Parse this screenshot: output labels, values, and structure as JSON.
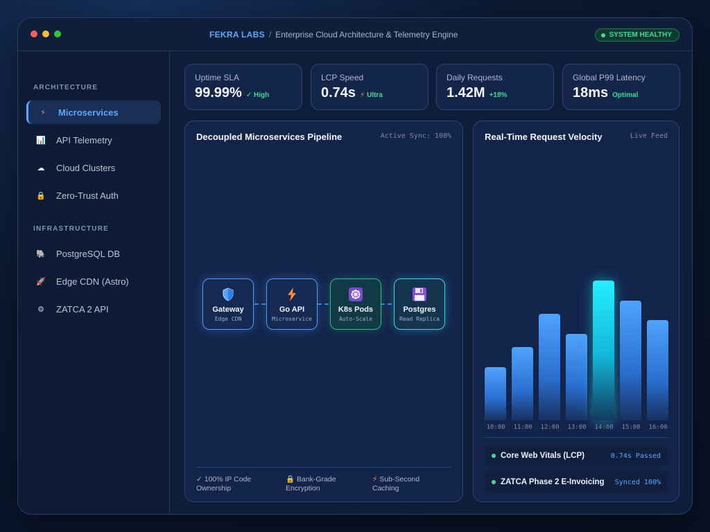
{
  "titlebar": {
    "brand": "FEKRA LABS",
    "separator": "/",
    "title": "Enterprise Cloud Architecture & Telemetry Engine",
    "status": "SYSTEM HEALTHY"
  },
  "sidebar": {
    "architecture_title": "ARCHITECTURE",
    "architecture_items": [
      {
        "label": "Microservices",
        "icon": "⚡",
        "icon_name": "lightning-icon"
      },
      {
        "label": "API Telemetry",
        "icon": "📊",
        "icon_name": "bar-chart-icon"
      },
      {
        "label": "Cloud Clusters",
        "icon": "☁",
        "icon_name": "cloud-icon"
      },
      {
        "label": "Zero-Trust Auth",
        "icon": "🔒",
        "icon_name": "lock-icon"
      }
    ],
    "infrastructure_title": "INFRASTRUCTURE",
    "infrastructure_items": [
      {
        "label": "PostgreSQL DB",
        "icon": "🐘",
        "icon_name": "elephant-icon"
      },
      {
        "label": "Edge CDN (Astro)",
        "icon": "🚀",
        "icon_name": "rocket-icon"
      },
      {
        "label": "ZATCA 2 API",
        "icon": "⚙",
        "icon_name": "gear-icon"
      }
    ]
  },
  "kpis": [
    {
      "label": "Uptime SLA",
      "value": "99.99%",
      "tag": "✓ High"
    },
    {
      "label": "LCP Speed",
      "value": "0.74s",
      "tag_icon": "⚡",
      "tag": "Ultra"
    },
    {
      "label": "Daily Requests",
      "value": "1.42M",
      "tag": "+18%"
    },
    {
      "label": "Global P99 Latency",
      "value": "18ms",
      "tag": "Optimal"
    }
  ],
  "pipeline": {
    "title": "Decoupled Microservices Pipeline",
    "meta": "Active Sync: 100%",
    "nodes": [
      {
        "name": "Gateway",
        "sub": "Edge CDN",
        "icon": "shield-icon"
      },
      {
        "name": "Go API",
        "sub": "Microservice",
        "icon": "lightning-icon"
      },
      {
        "name": "K8s Pods",
        "sub": "Auto-Scale",
        "icon": "helm-wheel-icon"
      },
      {
        "name": "Postgres",
        "sub": "Read Replica",
        "icon": "floppy-disk-icon"
      }
    ],
    "features": [
      {
        "icon": "✓",
        "text1": "100% IP Code",
        "text2": "Ownership"
      },
      {
        "icon": "🔒",
        "text1": "Bank-Grade",
        "text2": "Encryption"
      },
      {
        "icon": "⚡",
        "text1": "Sub-Second",
        "text2": "Caching"
      }
    ]
  },
  "velocity": {
    "title": "Real-Time Request Velocity",
    "meta": "Live Feed",
    "statuses": [
      {
        "label": "Core Web Vitals (LCP)",
        "value": "0.74s Passed"
      },
      {
        "label": "ZATCA Phase 2 E-Invoicing",
        "value": "Synced 100%"
      }
    ]
  },
  "chart_data": {
    "type": "bar",
    "categories": [
      "10:00",
      "11:00",
      "12:00",
      "13:00",
      "14:00",
      "15:00",
      "16:00"
    ],
    "values": [
      40,
      55,
      80,
      65,
      105,
      90,
      75
    ],
    "ylim": [
      0,
      110
    ],
    "highlight_index": 4,
    "grid": false,
    "colors": {
      "bar": "#4fa3ff",
      "peak": "#22f0ff"
    }
  }
}
